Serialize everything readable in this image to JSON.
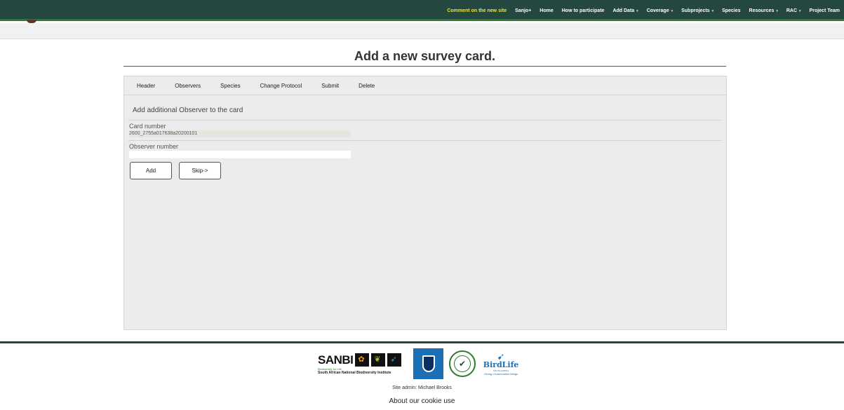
{
  "nav": {
    "items": [
      {
        "label": "Comment on the new site",
        "highlight": true,
        "caret": false
      },
      {
        "label": "Sanjo+",
        "highlight": false,
        "caret": false
      },
      {
        "label": "Home",
        "highlight": false,
        "caret": false
      },
      {
        "label": "How to participate",
        "highlight": false,
        "caret": false
      },
      {
        "label": "Add Data",
        "highlight": false,
        "caret": true
      },
      {
        "label": "Coverage",
        "highlight": false,
        "caret": true
      },
      {
        "label": "Subprojects",
        "highlight": false,
        "caret": true
      },
      {
        "label": "Species",
        "highlight": false,
        "caret": false
      },
      {
        "label": "Resources",
        "highlight": false,
        "caret": true
      },
      {
        "label": "RAC",
        "highlight": false,
        "caret": true
      },
      {
        "label": "Project Team",
        "highlight": false,
        "caret": false
      }
    ],
    "caret_glyph": "▾",
    "highlight_color": "#f4e22b",
    "bar_color": "#24483f"
  },
  "page": {
    "title": "Add a new survey card."
  },
  "tabs": {
    "items": [
      "Header",
      "Observers",
      "Species",
      "Change Protocol",
      "Submit",
      "Delete"
    ]
  },
  "form": {
    "section_title": "Add additional Observer to the card",
    "card_number_label": "Card number",
    "card_number_value": "2600_2755a017638a20200101",
    "observer_number_label": "Observer number",
    "observer_number_value": "",
    "add_label": "Add",
    "skip_label": "Skip->"
  },
  "footer": {
    "sanbi_word": "SANBI",
    "sanbi_tagline": "Biodiversity for Life",
    "sanbi_name": "South African National Biodiversity Institute",
    "birdlife_word": "BirdLife",
    "birdlife_region": "SOUTH AFRICA",
    "birdlife_tagline": "Giving Conservation Wings",
    "site_admin": "Site admin: Michael Brooks",
    "cookie": "About our cookie use"
  }
}
